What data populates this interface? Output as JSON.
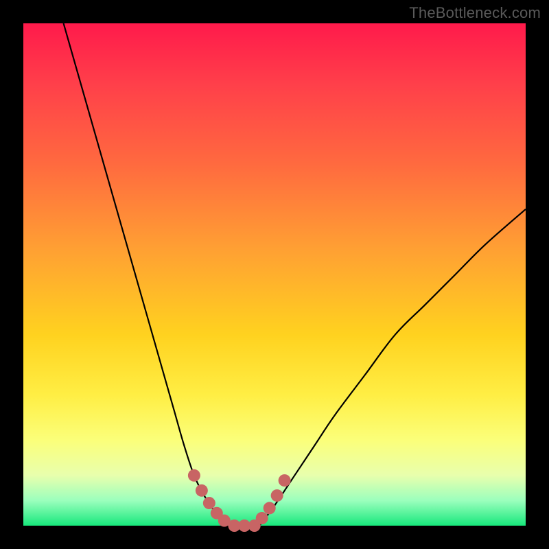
{
  "attribution": "TheBottleneck.com",
  "colors": {
    "frame": "#000000",
    "curve": "#000000",
    "marker": "#c86464",
    "gradient_top": "#ff1a4b",
    "gradient_bottom": "#17e87c"
  },
  "chart_data": {
    "type": "line",
    "title": "",
    "xlabel": "",
    "ylabel": "",
    "xlim": [
      0,
      100
    ],
    "ylim": [
      0,
      100
    ],
    "series": [
      {
        "name": "bottleneck-curve-left",
        "x": [
          8,
          12,
          16,
          20,
          24,
          28,
          30,
          32,
          34,
          36,
          38,
          40,
          41
        ],
        "y": [
          100,
          86,
          72,
          58,
          44,
          30,
          23,
          16,
          10,
          6,
          3,
          1,
          0
        ]
      },
      {
        "name": "bottleneck-curve-right",
        "x": [
          47,
          50,
          54,
          58,
          62,
          68,
          74,
          80,
          86,
          92,
          100
        ],
        "y": [
          0,
          4,
          10,
          16,
          22,
          30,
          38,
          44,
          50,
          56,
          63
        ]
      },
      {
        "name": "flat-minimum",
        "x": [
          41,
          47
        ],
        "y": [
          0,
          0
        ]
      }
    ],
    "markers": {
      "name": "highlighted-dots",
      "x": [
        34,
        35.5,
        37,
        38.5,
        40,
        42,
        44,
        46,
        47.5,
        49,
        50.5,
        52
      ],
      "y": [
        10,
        7,
        4.5,
        2.5,
        1,
        0,
        0,
        0,
        1.5,
        3.5,
        6,
        9
      ]
    }
  }
}
